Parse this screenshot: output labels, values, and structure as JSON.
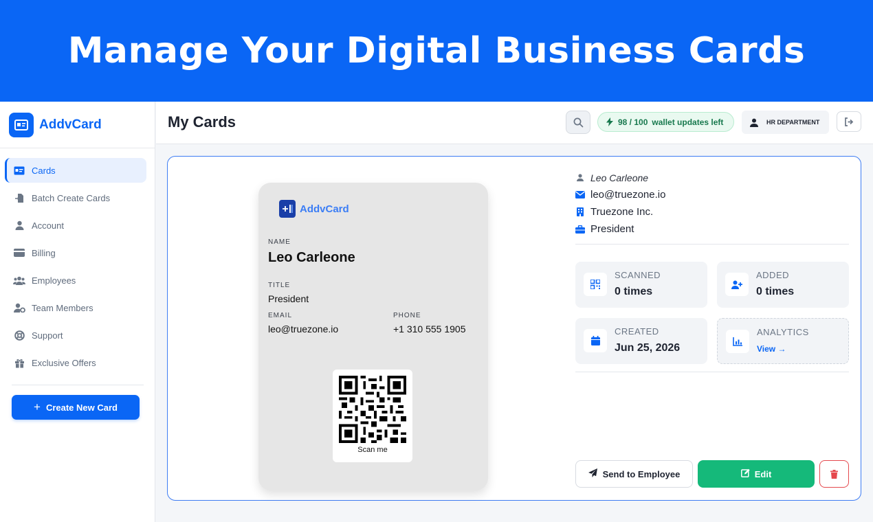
{
  "banner": {
    "headline": "Manage Your Digital Business Cards"
  },
  "brand": {
    "name": "AddvCard",
    "color": "#0a66f5"
  },
  "sidebar": {
    "items": [
      {
        "label": "Cards",
        "icon": "id-card-icon",
        "active": true
      },
      {
        "label": "Batch Create Cards",
        "icon": "file-import-icon"
      },
      {
        "label": "Account",
        "icon": "user-icon"
      },
      {
        "label": "Billing",
        "icon": "credit-card-icon"
      },
      {
        "label": "Employees",
        "icon": "users-icon"
      },
      {
        "label": "Team Members",
        "icon": "user-gear-icon"
      },
      {
        "label": "Support",
        "icon": "life-ring-icon"
      },
      {
        "label": "Exclusive Offers",
        "icon": "gift-icon"
      }
    ],
    "create_button": "Create New Card"
  },
  "header": {
    "title": "My Cards",
    "wallet": {
      "count": "98 / 100",
      "text": "wallet updates left",
      "color": "#18794e"
    },
    "department": "HR DEPARTMENT"
  },
  "card_preview": {
    "logo_text": "AddvCard",
    "name_label": "NAME",
    "name": "Leo Carleone",
    "title_label": "TITLE",
    "title": "President",
    "email_label": "EMAIL",
    "email": "leo@truezone.io",
    "phone_label": "PHONE",
    "phone": "+1 310 555 1905",
    "qr_caption": "Scan me"
  },
  "details": {
    "name": "Leo Carleone",
    "email": "leo@truezone.io",
    "company": "Truezone Inc.",
    "title": "President"
  },
  "stats": {
    "scanned": {
      "label": "SCANNED",
      "value": "0 times"
    },
    "added": {
      "label": "ADDED",
      "value": "0 times"
    },
    "created": {
      "label": "CREATED",
      "value": "Jun 25, 2026"
    },
    "analytics": {
      "label": "ANALYTICS",
      "link": "View →"
    }
  },
  "actions": {
    "send": "Send to Employee",
    "edit": "Edit",
    "edit_color": "#15b97a",
    "delete_color": "#e5484d"
  }
}
